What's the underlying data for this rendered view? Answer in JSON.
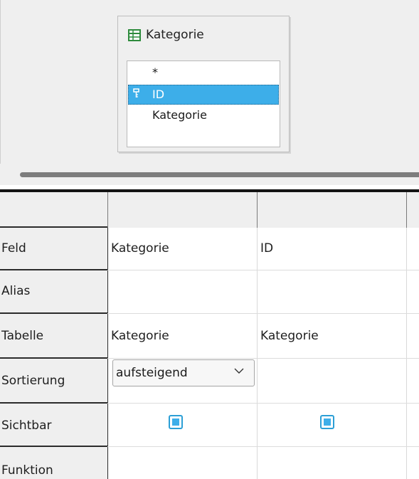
{
  "table_window": {
    "title": "Kategorie",
    "fields": [
      "*",
      "ID",
      "Kategorie"
    ],
    "selected_index": 1
  },
  "grid": {
    "row_labels": [
      "Feld",
      "Alias",
      "Tabelle",
      "Sortierung",
      "Sichtbar",
      "Funktion"
    ],
    "columns": [
      {
        "feld": "Kategorie",
        "alias": "",
        "tabelle": "Kategorie",
        "sortierung": "aufsteigend",
        "sichtbar": true
      },
      {
        "feld": "ID",
        "alias": "",
        "tabelle": "Kategorie",
        "sortierung": "",
        "sichtbar": true
      }
    ]
  },
  "colors": {
    "selection": "#3daee9",
    "background": "#efefef"
  }
}
